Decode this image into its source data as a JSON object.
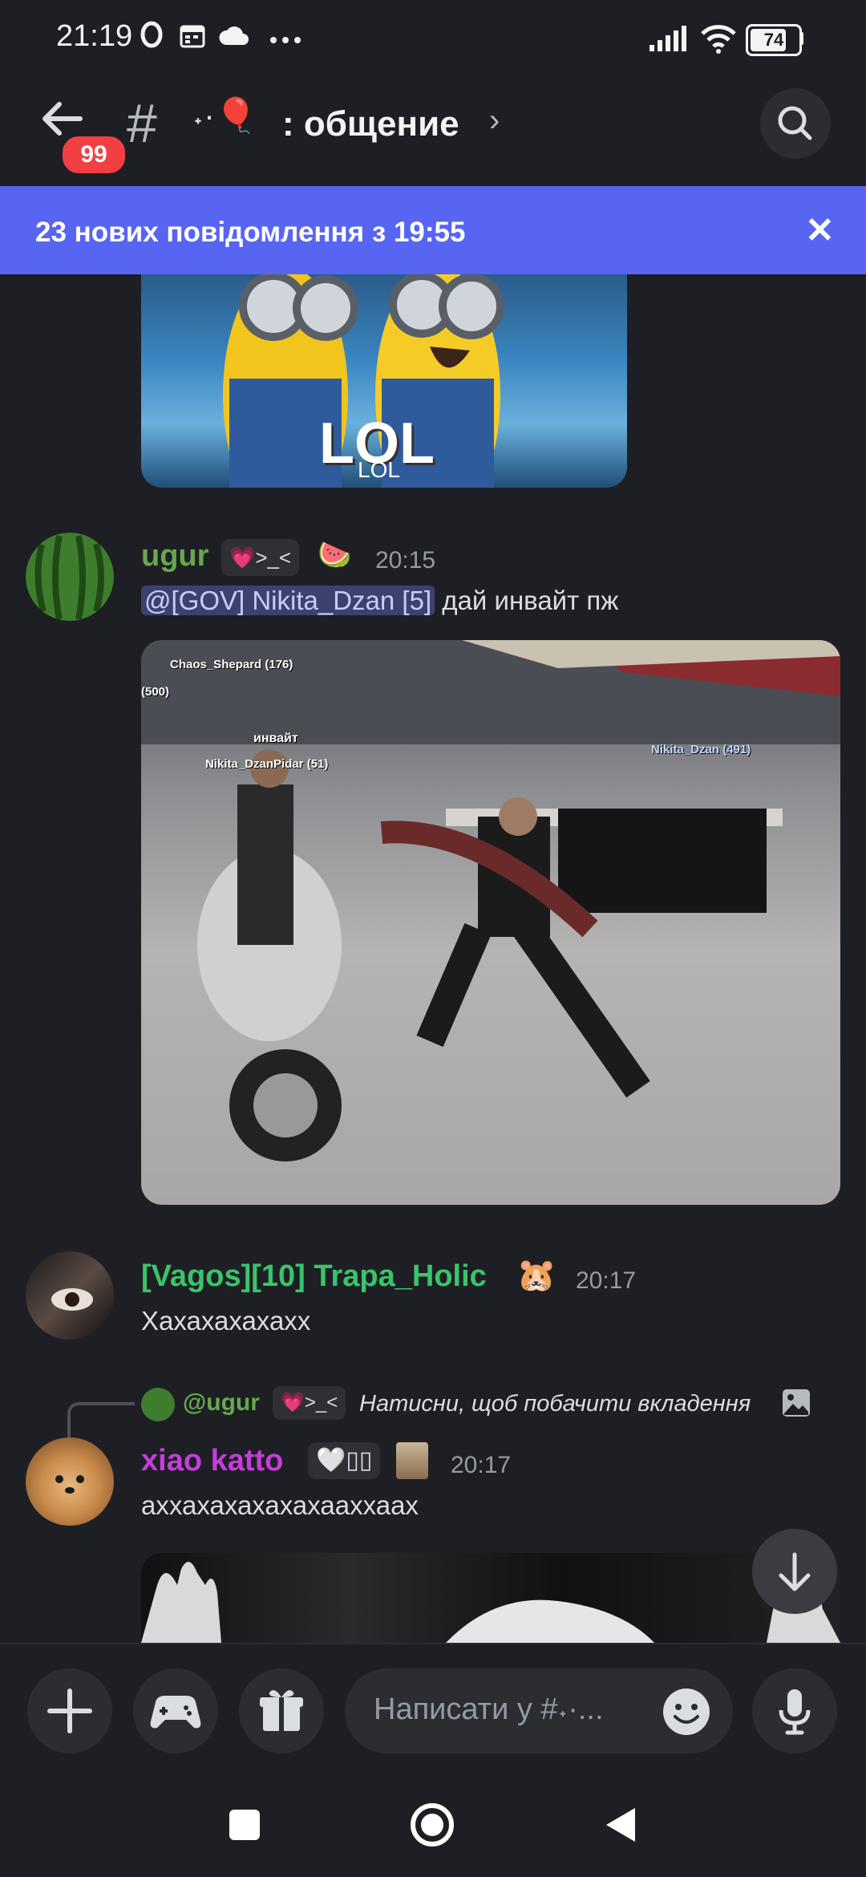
{
  "status_bar": {
    "time": "21:19",
    "battery": "74"
  },
  "header": {
    "back_badge": "99",
    "channel_emoji": "˖·🎈",
    "channel_name": ": общение",
    "chevron": "›"
  },
  "new_messages_bar": {
    "text": "23 нових повідомлення з 19:55",
    "close": "✕"
  },
  "messages": [
    {
      "username": "ugur",
      "user_color": "#67a84f",
      "tag": "💗>_<",
      "emoji": "🍉",
      "time": "20:15",
      "mention": "@[GOV] Nikita_Dzan [5]",
      "text": " дай инвайт пж"
    },
    {
      "username": "[Vagos][10] Trapa_Holic",
      "user_color": "#3ac46a",
      "emoji": "🐹",
      "time": "20:17",
      "text": "Хахахахахахх"
    },
    {
      "reply_user": "@ugur",
      "reply_tag": "💗>_<",
      "reply_text": "Натисни, щоб побачити вкладення",
      "username": "xiao katto",
      "user_color": "#c33ed8",
      "tag": "🤍▯▯",
      "time": "20:17",
      "text": "аххахахахахахааххаах"
    }
  ],
  "images": {
    "lol_caption": "LOL",
    "lol_small": "LOL",
    "game_labels": [
      "Chaos_Shepard (176)",
      "(500)",
      "инвайт",
      "Nikita_DzanPidar (51)",
      "Nikita_Dzan (491)"
    ]
  },
  "composer": {
    "placeholder": "Написати у #˖·..."
  },
  "colors": {
    "accent": "#5865f2",
    "background": "#1e1f24",
    "badge": "#f23f43"
  }
}
